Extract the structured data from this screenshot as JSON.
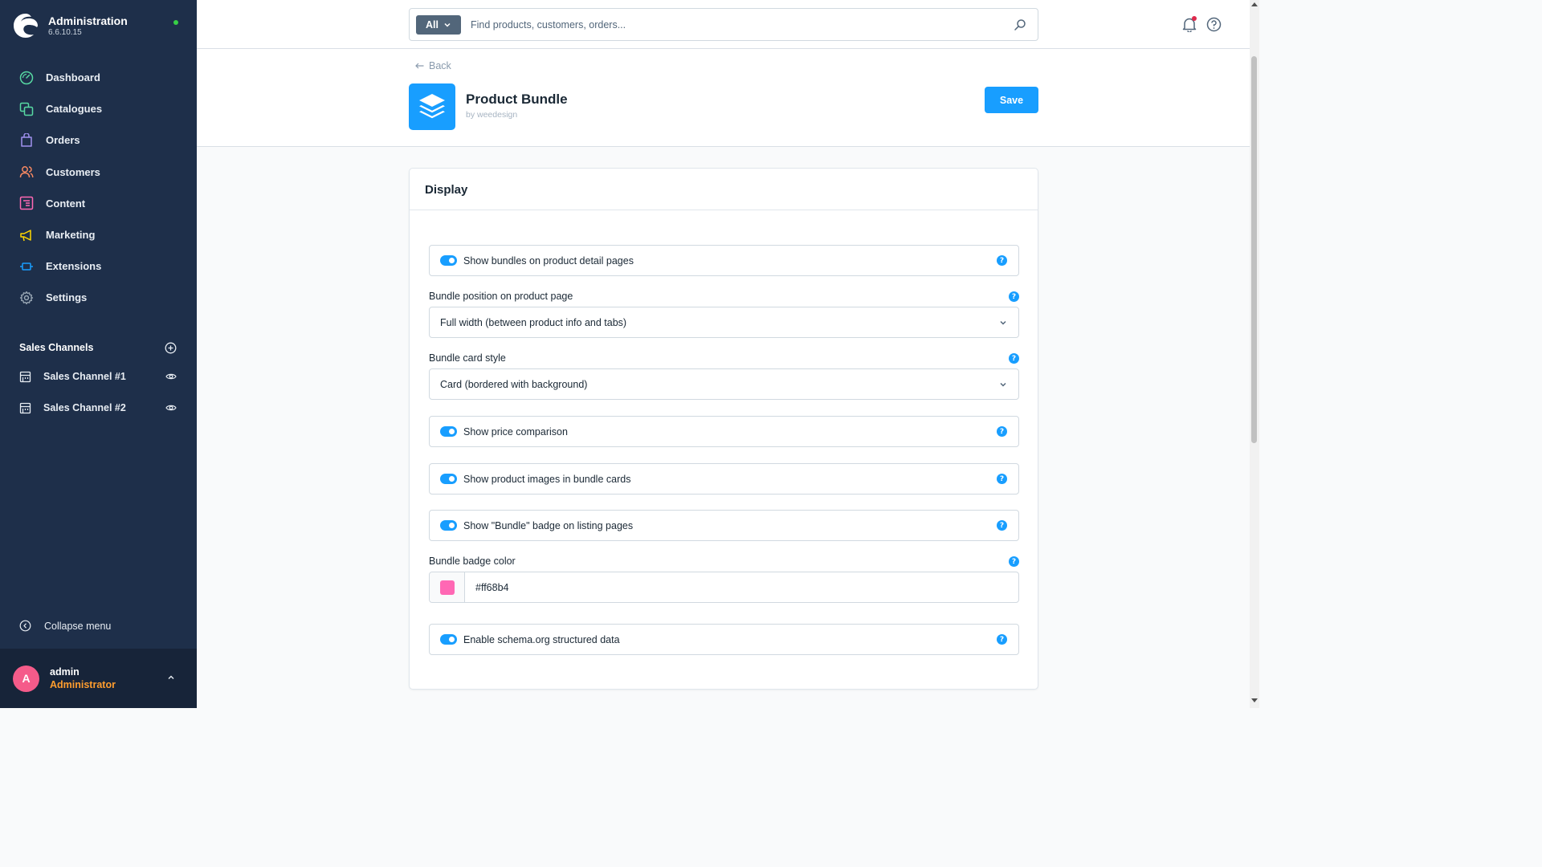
{
  "app": {
    "title": "Administration",
    "version": "6.6.10.15"
  },
  "sidebar": {
    "items": [
      {
        "label": "Dashboard",
        "icon": "dashboard-icon",
        "color": "#57d9a3"
      },
      {
        "label": "Catalogues",
        "icon": "catalogues-icon",
        "color": "#57d9a3"
      },
      {
        "label": "Orders",
        "icon": "orders-icon",
        "color": "#a092f0"
      },
      {
        "label": "Customers",
        "icon": "customers-icon",
        "color": "#f88962"
      },
      {
        "label": "Content",
        "icon": "content-icon",
        "color": "#ff68b4"
      },
      {
        "label": "Marketing",
        "icon": "marketing-icon",
        "color": "#ffd700"
      },
      {
        "label": "Extensions",
        "icon": "extensions-icon",
        "color": "#189eff"
      },
      {
        "label": "Settings",
        "icon": "settings-icon",
        "color": "#9aa8b5"
      }
    ],
    "sales_channels_label": "Sales Channels",
    "sales_channels": [
      {
        "label": "Sales Channel #1"
      },
      {
        "label": "Sales Channel #2"
      }
    ],
    "collapse_label": "Collapse menu"
  },
  "user": {
    "initial": "A",
    "name": "admin",
    "role": "Administrator"
  },
  "search": {
    "type_label": "All",
    "placeholder": "Find products, customers, orders..."
  },
  "page": {
    "back_label": "Back",
    "app_title": "Product Bundle",
    "app_vendor": "by weedesign",
    "save_label": "Save"
  },
  "card": {
    "title": "Display",
    "show_bundles_label": "Show bundles on product detail pages",
    "bundle_position_label": "Bundle position on product page",
    "bundle_position_value": "Full width (between product info and tabs)",
    "bundle_card_style_label": "Bundle card style",
    "bundle_card_style_value": "Card (bordered with background)",
    "show_price_comparison_label": "Show price comparison",
    "show_product_images_label": "Show product images in bundle cards",
    "show_badge_label": "Show \"Bundle\" badge on listing pages",
    "badge_color_label": "Bundle badge color",
    "badge_color_value": "#ff68b4",
    "schema_label": "Enable schema.org structured data"
  },
  "colors": {
    "accent": "#189eff",
    "sidebar_bg": "#1e2f4a",
    "badge_color": "#ff68b4",
    "online_status": "#37d046"
  }
}
